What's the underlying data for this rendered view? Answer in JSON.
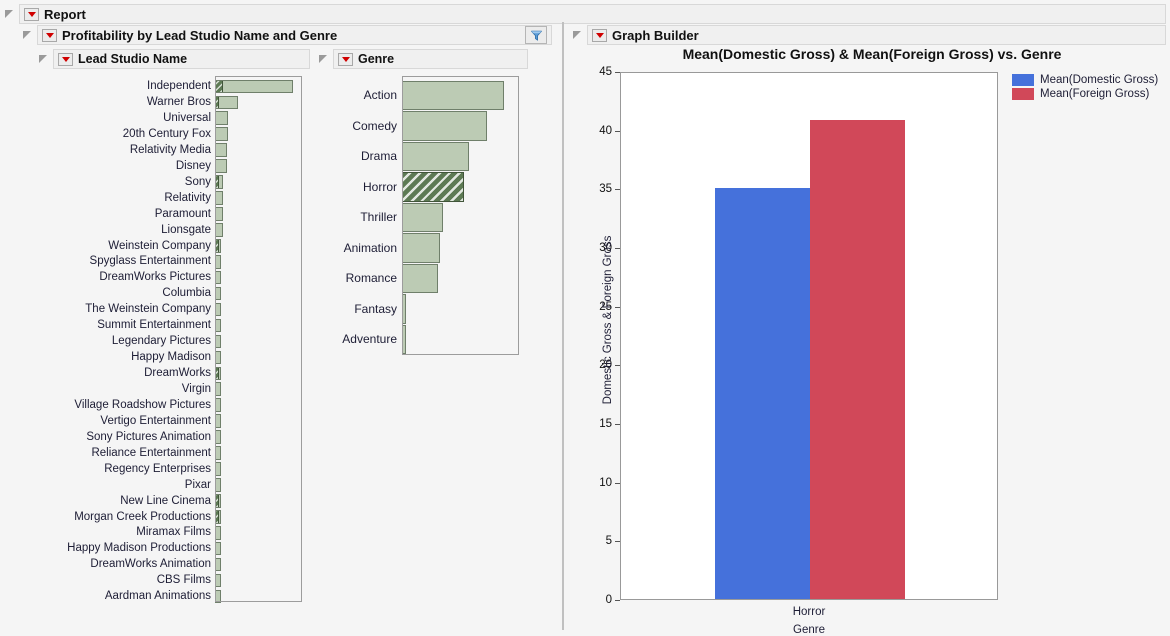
{
  "report": {
    "title": "Report",
    "dropdown_icon": "red-triangle-down-icon",
    "disclosure_icon": "disclosure-triangle-icon"
  },
  "profitability": {
    "title": "Profitability by Lead Studio Name and Genre",
    "filter_icon": "funnel-filter-icon"
  },
  "studio_panel": {
    "title": "Lead Studio Name",
    "chart_data": {
      "type": "bar",
      "orientation": "horizontal",
      "title": "Lead Studio Name",
      "xlabel": "",
      "ylabel": "",
      "grid": false,
      "legend": "none",
      "selected_category_color": "#5d7a54",
      "bar_color": "#bccbb4",
      "categories": [
        "Independent",
        "Warner Bros",
        "Universal",
        "20th Century Fox",
        "Relativity Media",
        "Disney",
        "Sony",
        "Relativity",
        "Paramount",
        "Lionsgate",
        "Weinstein Company",
        "Spyglass Entertainment",
        "DreamWorks Pictures",
        "Columbia",
        "The Weinstein Company",
        "Summit Entertainment",
        "Legendary Pictures",
        "Happy Madison",
        "DreamWorks",
        "Virgin",
        "Village Roadshow Pictures",
        "Vertigo Entertainment",
        "Sony Pictures Animation",
        "Reliance Entertainment",
        "Regency Enterprises",
        "Pixar",
        "New Line Cinema",
        "Morgan Creek Productions",
        "Miramax Films",
        "Happy Madison Productions",
        "DreamWorks Animation",
        "CBS Films",
        "Aardman Animations"
      ],
      "values": [
        74,
        22,
        12,
        12,
        11,
        11,
        8,
        8,
        8,
        8,
        5,
        3,
        3,
        3,
        2,
        2,
        2,
        2,
        2,
        1,
        1,
        1,
        1,
        1,
        1,
        1,
        1,
        1,
        1,
        1,
        1,
        1,
        1
      ],
      "selected_values": [
        7,
        3,
        0,
        0,
        0,
        0,
        2,
        0,
        0,
        0,
        2,
        0,
        0,
        0,
        0,
        0,
        0,
        0,
        2,
        0,
        0,
        0,
        0,
        0,
        0,
        0,
        1,
        1,
        0,
        0,
        0,
        0,
        0
      ]
    }
  },
  "genre_panel": {
    "title": "Genre",
    "chart_data": {
      "type": "bar",
      "orientation": "horizontal",
      "title": "Genre",
      "xlabel": "",
      "ylabel": "",
      "grid": false,
      "legend": "none",
      "bar_color": "#bccbb4",
      "selected_category": "Horror",
      "selected_category_color": "#5d7a54",
      "categories": [
        "Action",
        "Comedy",
        "Drama",
        "Horror",
        "Thriller",
        "Animation",
        "Romance",
        "Fantasy",
        "Adventure"
      ],
      "values": [
        101,
        84,
        66,
        61,
        41,
        38,
        36,
        4,
        2
      ]
    }
  },
  "graph_builder": {
    "title": "Graph Builder",
    "chart_data": {
      "type": "bar",
      "title": "Mean(Domestic Gross) & Mean(Foreign Gross) vs. Genre",
      "xlabel": "Genre",
      "ylabel": "Domestic Gross & Foreign Gross",
      "categories": [
        "Horror"
      ],
      "series": [
        {
          "name": "Mean(Domestic Gross)",
          "values": [
            35.0
          ],
          "color": "#4571db"
        },
        {
          "name": "Mean(Foreign Gross)",
          "values": [
            40.8
          ],
          "color": "#d14859"
        }
      ],
      "ylim": [
        0,
        45
      ],
      "yticks": [
        "0",
        "5",
        "10",
        "15",
        "20",
        "25",
        "30",
        "35",
        "40",
        "45"
      ],
      "grid": false,
      "legend_position": "right"
    }
  }
}
